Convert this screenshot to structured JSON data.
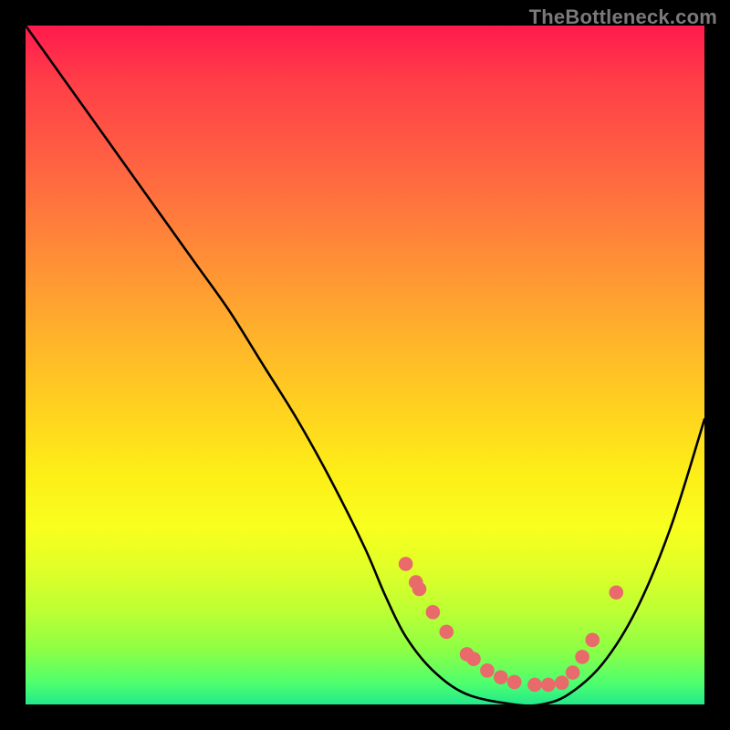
{
  "attribution": "TheBottleneck.com",
  "chart_data": {
    "type": "line",
    "title": "",
    "xlabel": "",
    "ylabel": "",
    "xlim": [
      0,
      1
    ],
    "ylim": [
      0,
      1
    ],
    "series": [
      {
        "name": "curve",
        "x": [
          0.0,
          0.05,
          0.1,
          0.15,
          0.2,
          0.25,
          0.3,
          0.35,
          0.4,
          0.45,
          0.5,
          0.53,
          0.56,
          0.6,
          0.65,
          0.72,
          0.76,
          0.8,
          0.85,
          0.9,
          0.95,
          1.0
        ],
        "y": [
          1.0,
          0.93,
          0.86,
          0.79,
          0.72,
          0.65,
          0.58,
          0.5,
          0.42,
          0.33,
          0.23,
          0.16,
          0.1,
          0.05,
          0.015,
          0.0,
          0.0,
          0.015,
          0.06,
          0.14,
          0.26,
          0.42
        ]
      },
      {
        "name": "markers",
        "x": [
          0.56,
          0.575,
          0.58,
          0.6,
          0.62,
          0.65,
          0.66,
          0.68,
          0.7,
          0.72,
          0.75,
          0.77,
          0.79,
          0.806,
          0.82,
          0.835,
          0.87
        ],
        "y": [
          0.207,
          0.18,
          0.17,
          0.136,
          0.107,
          0.074,
          0.067,
          0.05,
          0.04,
          0.033,
          0.029,
          0.029,
          0.032,
          0.047,
          0.07,
          0.095,
          0.165
        ],
        "color": "#e86a6a"
      }
    ],
    "background_gradient": {
      "direction": "vertical",
      "stops": [
        {
          "pos": 0.0,
          "color": "#ff1a4d"
        },
        {
          "pos": 0.18,
          "color": "#ff5b43"
        },
        {
          "pos": 0.38,
          "color": "#ff9a33"
        },
        {
          "pos": 0.58,
          "color": "#ffd61e"
        },
        {
          "pos": 0.74,
          "color": "#f8ff1e"
        },
        {
          "pos": 0.86,
          "color": "#beff33"
        },
        {
          "pos": 0.97,
          "color": "#4cff70"
        },
        {
          "pos": 1.0,
          "color": "#22e98a"
        }
      ]
    }
  }
}
